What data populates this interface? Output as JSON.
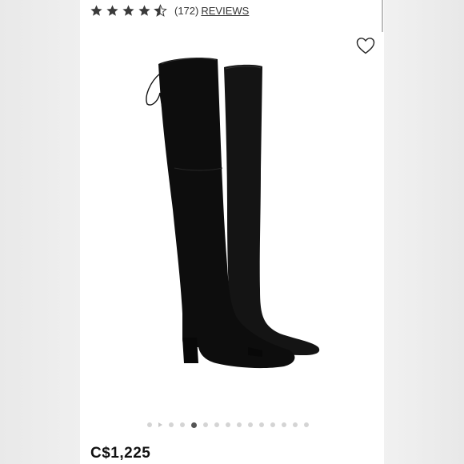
{
  "product": {
    "rating": 4.5,
    "rating_max": 5,
    "review_count": "(172)",
    "reviews_label": "REVIEWS",
    "price": "C$1,225"
  },
  "carousel": {
    "total": 15,
    "active_index": 4
  },
  "icons": {
    "wishlist": "heart-outline-icon",
    "star": "star-icon"
  },
  "colors": {
    "text": "#333333",
    "star": "#3a3a3a",
    "dot_active": "#555555",
    "dot": "#d4d4d4"
  }
}
